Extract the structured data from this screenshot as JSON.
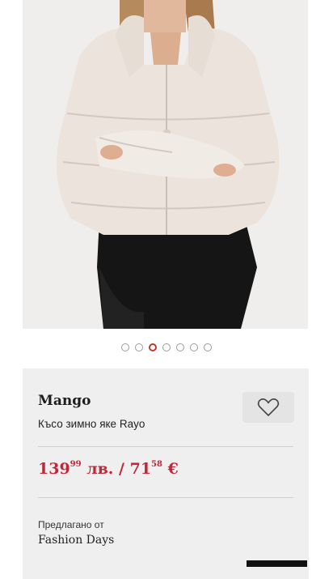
{
  "gallery": {
    "image_alt": "Късо зимно яке Rayo",
    "dot_count": 7,
    "active_index": 2,
    "accent_color": "#c0392b"
  },
  "product": {
    "brand": "Mango",
    "name": "Късо зимно яке Rayo",
    "price_bgn_main": "139",
    "price_bgn_cents": "99",
    "price_bgn_currency": " лв. / ",
    "price_eur_main": "71",
    "price_eur_cents": "58",
    "price_eur_currency": " €",
    "price_color": "#c0283a"
  },
  "seller": {
    "label": "Предлагано от",
    "name": "Fashion Days"
  },
  "icons": {
    "wishlist": "heart-outline-icon"
  }
}
